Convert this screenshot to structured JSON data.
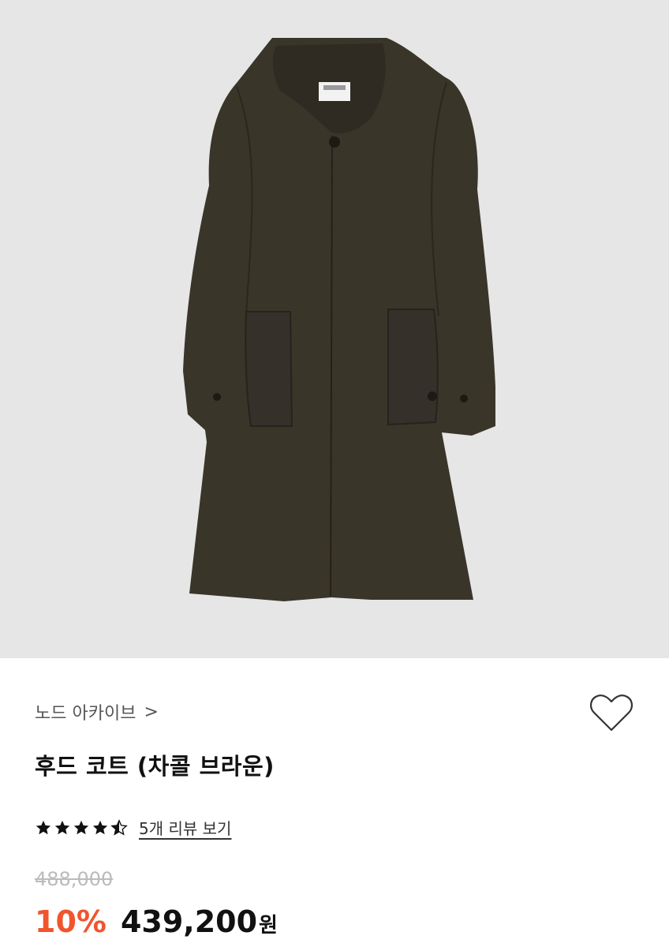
{
  "product": {
    "brand": "노드 아카이브",
    "brand_chevron": ">",
    "name": "후드 코트 (차콜 브라운)",
    "image_subject": "hooded coat, charcoal brown",
    "rating": 4.5,
    "review_link": "5개 리뷰 보기",
    "original_price": "488,000",
    "discount": "10%",
    "price": "439,200",
    "currency": "원"
  },
  "icons": {
    "wishlist": "heart-outline-icon",
    "chevron": "chevron-right-icon",
    "star": "star-icon"
  },
  "colors": {
    "accent": "#f0552d",
    "coat": "#3a3529",
    "image_bg": "#e6e6e6",
    "strike": "#bbbbbb"
  }
}
